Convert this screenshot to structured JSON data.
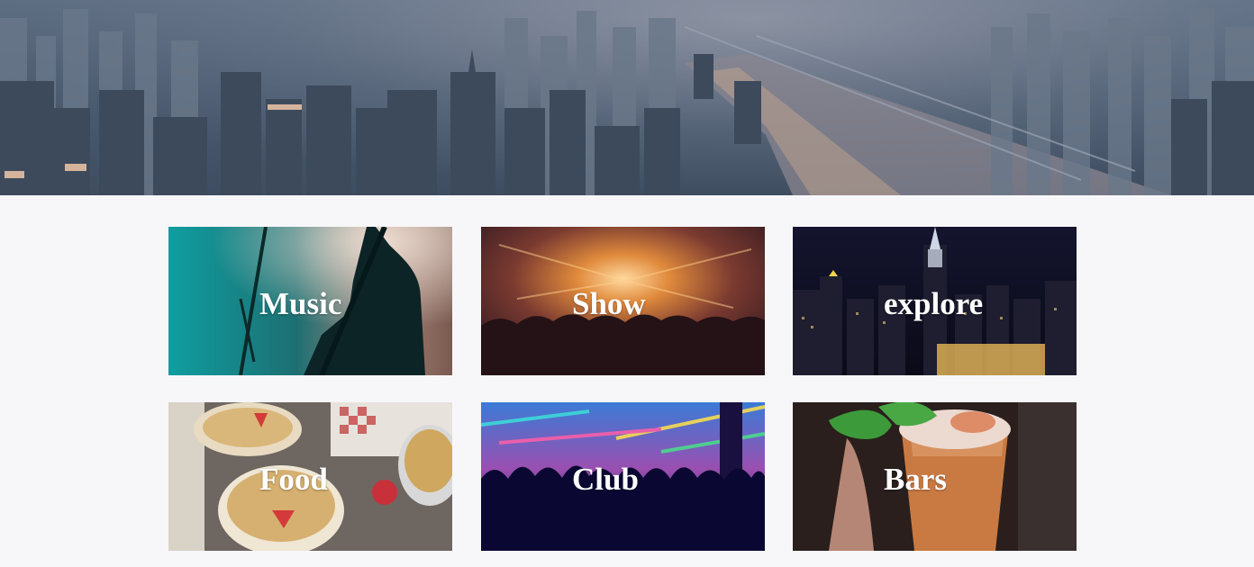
{
  "hero": {
    "image": "city-skyline-photo"
  },
  "cards": [
    {
      "label": "Music",
      "image": "guitarist-silhouette-photo"
    },
    {
      "label": "Show",
      "image": "concert-crowd-photo"
    },
    {
      "label": "explore",
      "image": "night-city-skyline-photo"
    },
    {
      "label": "Food",
      "image": "oatmeal-strawberry-photo"
    },
    {
      "label": "Club",
      "image": "club-crowd-lights-photo"
    },
    {
      "label": "Bars",
      "image": "mint-cocktail-photo"
    }
  ]
}
